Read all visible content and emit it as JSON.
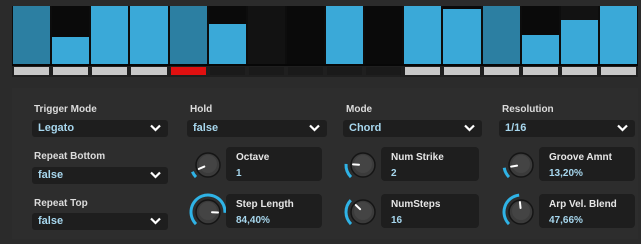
{
  "colors": {
    "bar_bright": "#3aa9d8",
    "bar_muted": "#2c7fa2",
    "step_dark": "#0e0e0e",
    "accent_cyan": "#2fb3e6",
    "value_text": "#a7d7ee",
    "active_tab": "#e01010"
  },
  "sequencer": {
    "steps": [
      {
        "level": 1.0,
        "style": "muted"
      },
      {
        "level": 0.52,
        "style": "bright"
      },
      {
        "level": 1.0,
        "style": "bright"
      },
      {
        "level": 1.0,
        "style": "bright"
      },
      {
        "level": 1.0,
        "style": "muted"
      },
      {
        "level": 0.72,
        "style": "bright"
      },
      {
        "level": 0.0,
        "style": "dark"
      },
      {
        "level": 0.0,
        "style": "dark"
      },
      {
        "level": 1.0,
        "style": "bright"
      },
      {
        "level": 0.0,
        "style": "dark"
      },
      {
        "level": 1.0,
        "style": "bright"
      },
      {
        "level": 0.95,
        "style": "bright"
      },
      {
        "level": 1.0,
        "style": "muted"
      },
      {
        "level": 0.55,
        "style": "bright"
      },
      {
        "level": 0.78,
        "style": "bright"
      },
      {
        "level": 1.0,
        "style": "bright"
      }
    ],
    "tabs": [
      "light",
      "light",
      "light",
      "light",
      "active",
      "dark",
      "dark",
      "dark",
      "dark",
      "dark",
      "light",
      "light",
      "light",
      "light",
      "light",
      "light"
    ]
  },
  "controls": {
    "trigger_mode": {
      "label": "Trigger Mode",
      "value": "Legato"
    },
    "hold": {
      "label": "Hold",
      "value": "false"
    },
    "mode": {
      "label": "Mode",
      "value": "Chord"
    },
    "resolution": {
      "label": "Resolution",
      "value": "1/16"
    },
    "repeat_bottom": {
      "label": "Repeat Bottom",
      "value": "false"
    },
    "repeat_top": {
      "label": "Repeat Top",
      "value": "false"
    }
  },
  "knobs": {
    "octave": {
      "label": "Octave",
      "value": "1",
      "fraction": 0.08
    },
    "num_strike": {
      "label": "Num Strike",
      "value": "2",
      "fraction": 0.18
    },
    "groove_amnt": {
      "label": "Groove Amnt",
      "value": "13,20%",
      "fraction": 0.132
    },
    "step_length": {
      "label": "Step Length",
      "value": "84,40%",
      "fraction": 0.844
    },
    "num_steps": {
      "label": "NumSteps",
      "value": "16",
      "fraction": 0.33
    },
    "arp_vel_blend": {
      "label": "Arp Vel. Blend",
      "value": "47,66%",
      "fraction": 0.4766
    }
  },
  "icons": {
    "dropdown": "chevron-down-icon"
  }
}
